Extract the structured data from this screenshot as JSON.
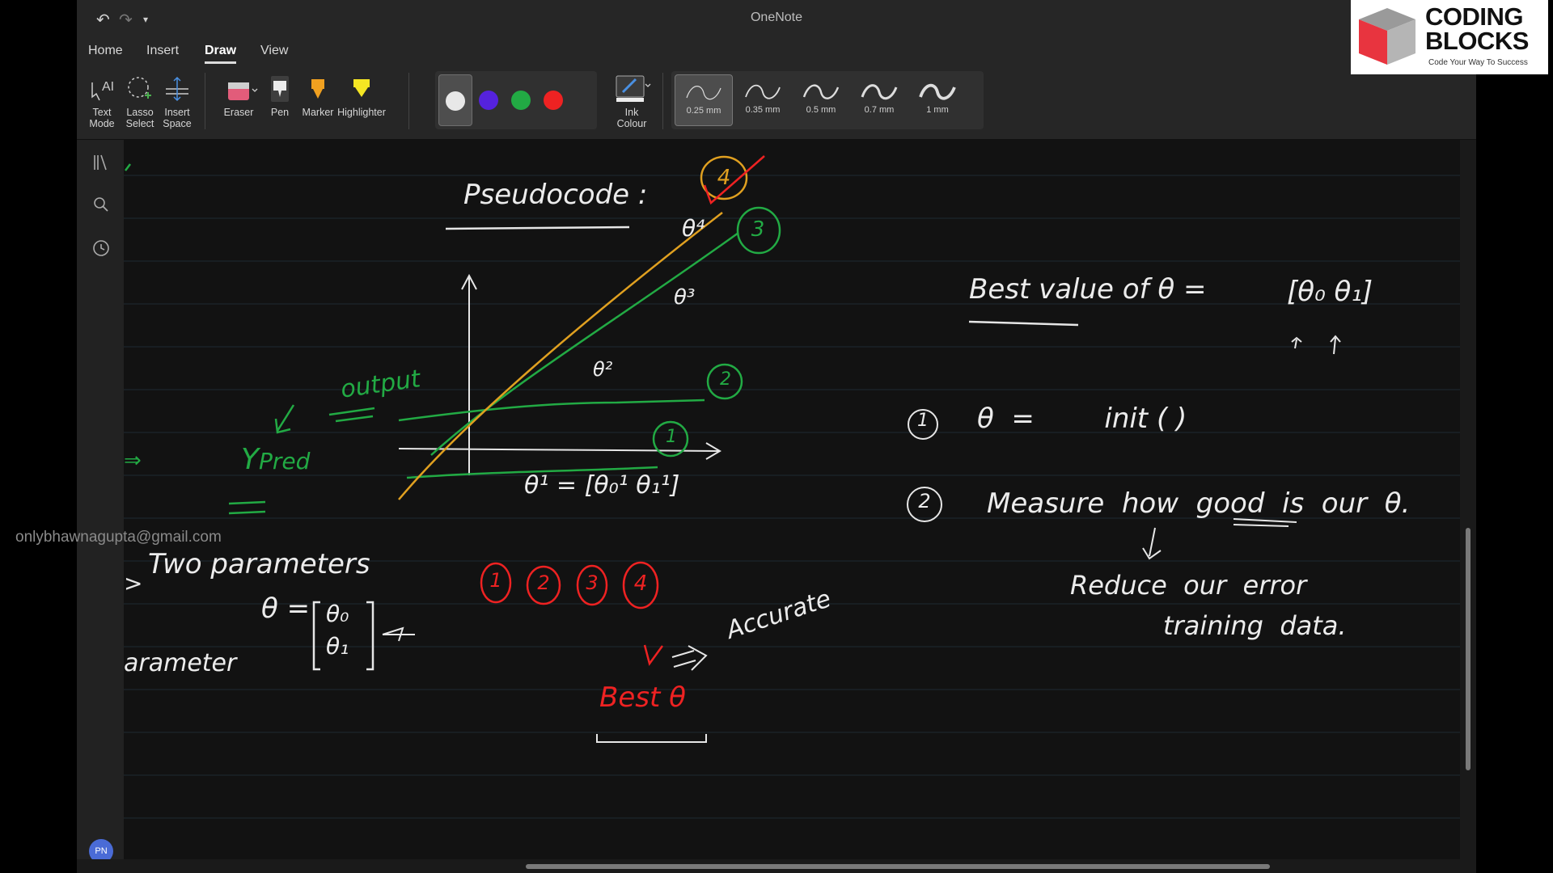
{
  "app": {
    "title": "OneNote"
  },
  "menu": {
    "tabs": [
      {
        "label": "Home"
      },
      {
        "label": "Insert"
      },
      {
        "label": "Draw"
      },
      {
        "label": "View"
      }
    ],
    "active_tab": "Draw"
  },
  "ribbon": {
    "tools": [
      {
        "label1": "Text",
        "label2": "Mode"
      },
      {
        "label1": "Lasso",
        "label2": "Select"
      },
      {
        "label1": "Insert",
        "label2": "Space"
      },
      {
        "label1": "Eraser",
        "label2": ""
      },
      {
        "label1": "Pen",
        "label2": ""
      },
      {
        "label1": "Marker",
        "label2": ""
      },
      {
        "label1": "Highlighter",
        "label2": ""
      }
    ],
    "ink_colour": {
      "label1": "Ink",
      "label2": "Colour"
    },
    "colors": [
      "#e8e8e8",
      "#5522dd",
      "#22aa44",
      "#ee2222"
    ],
    "selected_color": "#e8e8e8",
    "thicknesses": [
      "0.25 mm",
      "0.35 mm",
      "0.5 mm",
      "0.7 mm",
      "1 mm"
    ],
    "selected_thickness": "0.25 mm"
  },
  "sidebar": {
    "avatar_initials": "PN"
  },
  "branding": {
    "name_line1": "CODING",
    "name_line2": "BLOCKS",
    "tagline": "Code Your Way To Success"
  },
  "watermark": {
    "email": "onlybhawnagupta@gmail.com"
  },
  "notes": {
    "heading": "Pseudocode :",
    "output_label": "output",
    "ypred": "Y",
    "ypred_sub": "Pred",
    "two_parameters": "Two parameters",
    "theta_eq": "θ =",
    "theta0": "θ₀",
    "theta1": "θ₁",
    "parameter_word": "arameter",
    "graph_theta1": "θ¹ = [θ₀¹  θ₁¹]",
    "graph_theta2": "θ²",
    "graph_theta3": "θ³",
    "graph_theta4": "θ⁴",
    "circles_red": [
      "1",
      "2",
      "3",
      "4"
    ],
    "circles_green": [
      "1",
      "2",
      "3"
    ],
    "circle_orange": "4",
    "best_theta": "Best θ",
    "accurate": "Accurate",
    "best_value_line": "Best  value  of  θ  =",
    "best_value_vec": "[θ₀  θ₁]",
    "step1_num": "1",
    "step1_text": "θ  =        init ( )",
    "step2_num": "2",
    "step2_text": "Measure  how  good  is  our  θ.",
    "reduce_line1": "Reduce  our  error",
    "reduce_line2": "training  data."
  }
}
